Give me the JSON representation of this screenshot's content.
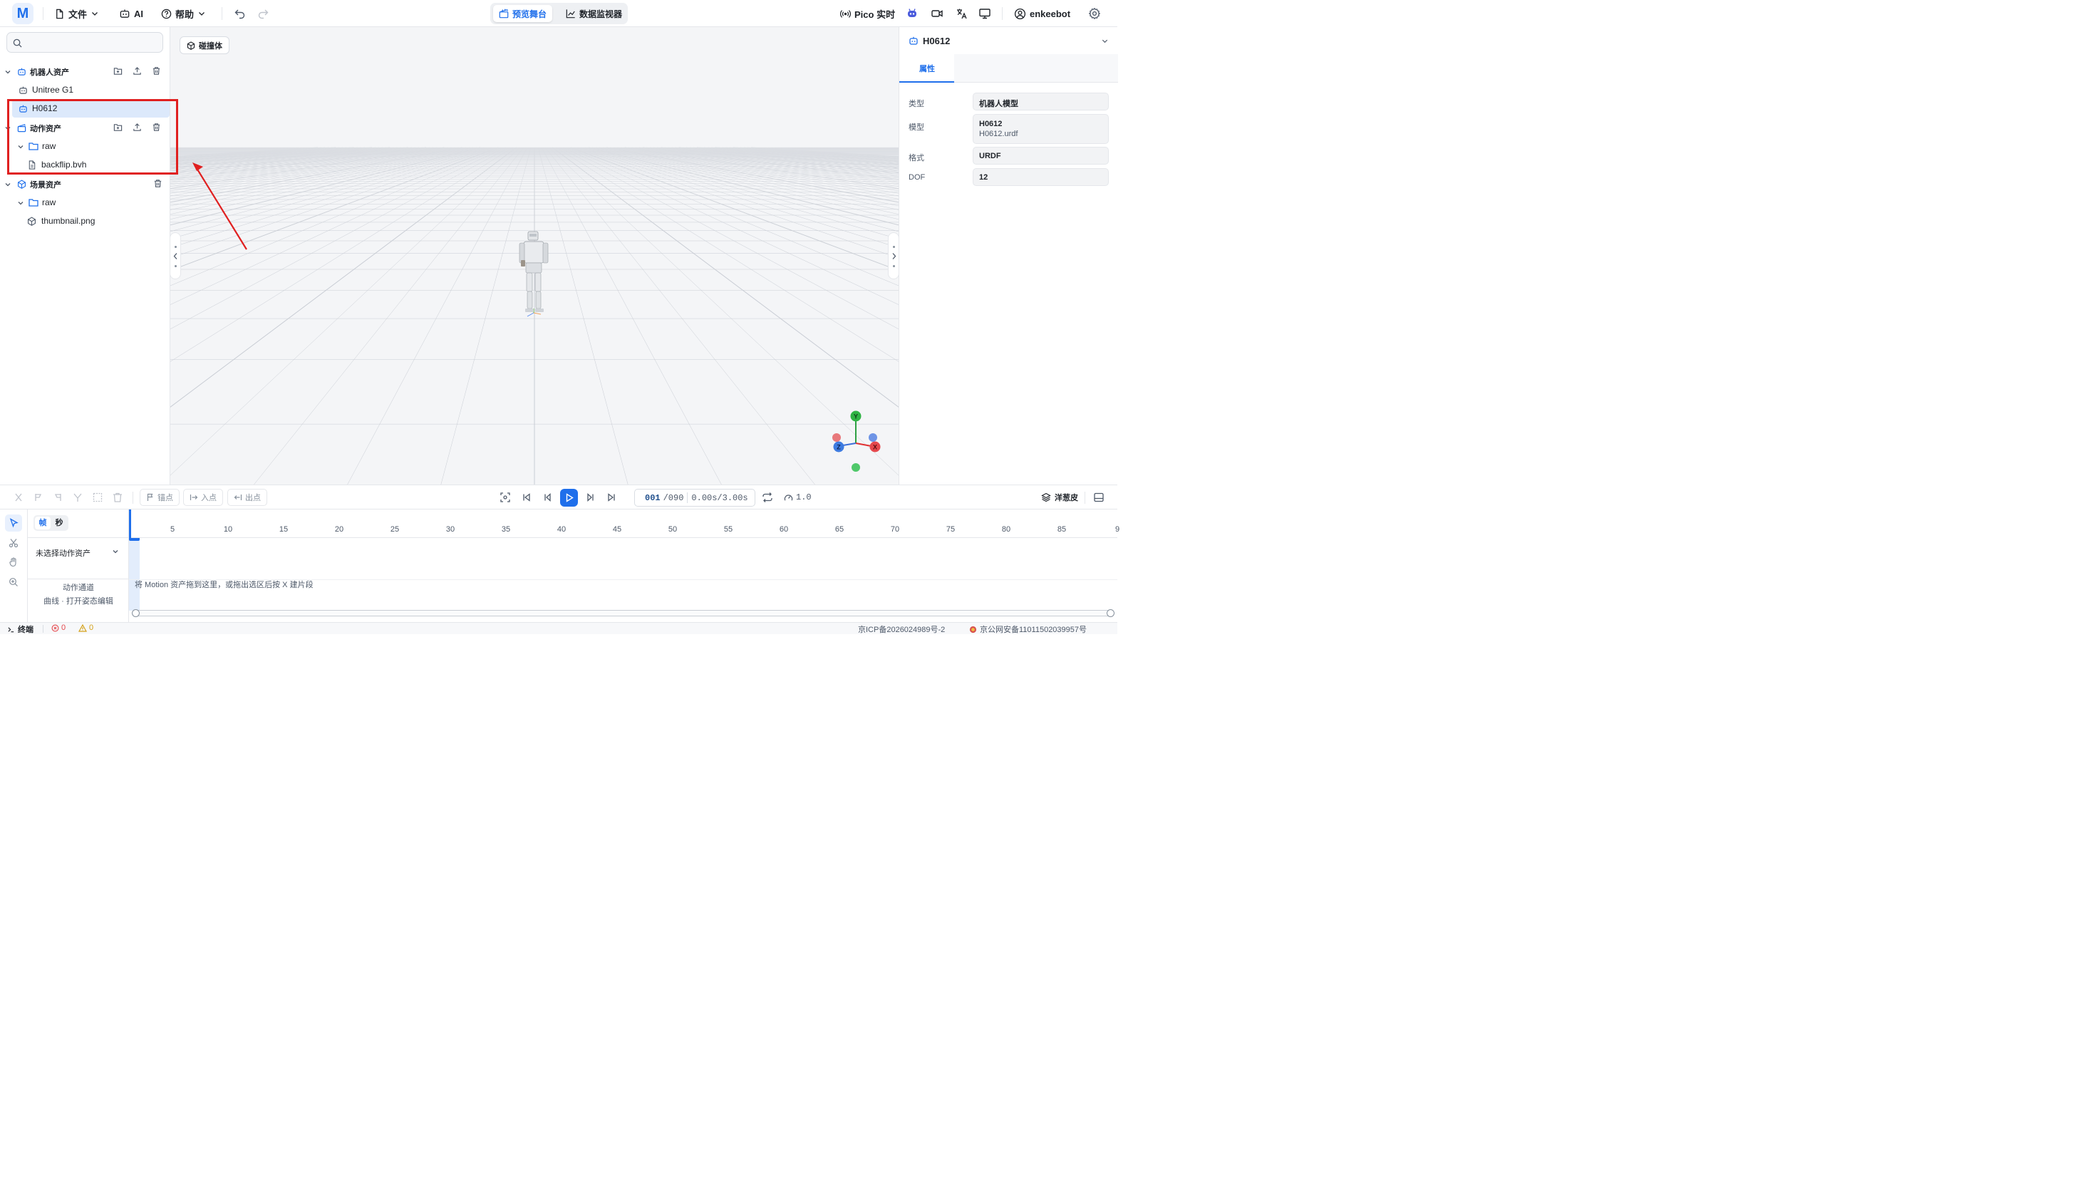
{
  "topbar": {
    "logo": "M",
    "file_menu": "文件",
    "ai_label": "AI",
    "help_menu": "帮助",
    "tabs": [
      {
        "label": "预览舞台",
        "active": true
      },
      {
        "label": "数据监视器",
        "active": false
      }
    ],
    "pico_label": "Pico 实时",
    "username": "enkeebot"
  },
  "left_panel": {
    "search_placeholder": "",
    "sections": [
      {
        "title": "机器人资产",
        "items": [
          "Unitree G1",
          "H0612"
        ],
        "selected": "H0612"
      },
      {
        "title": "动作资产",
        "folder": "raw",
        "files": [
          "backflip.bvh"
        ]
      },
      {
        "title": "场景资产",
        "folder": "raw",
        "files": [
          "thumbnail.png"
        ]
      }
    ]
  },
  "viewport": {
    "collision_button": "碰撞体",
    "axes": {
      "y": "Y",
      "x": "X",
      "z": "Z"
    }
  },
  "right_panel": {
    "title": "H0612",
    "tab": "属性",
    "properties": [
      {
        "label": "类型",
        "value": "机器人模型"
      },
      {
        "label": "模型",
        "value": "H0612",
        "sub": "H0612.urdf"
      },
      {
        "label": "格式",
        "value": "URDF"
      },
      {
        "label": "DOF",
        "value": "12"
      }
    ]
  },
  "timeline": {
    "anchor_btn": "锚点",
    "in_btn": "入点",
    "out_btn": "出点",
    "frame_current": "001",
    "frame_total": "/090",
    "time": "0.00s/3.00s",
    "speed": "1.0",
    "onion_skin": "洋葱皮",
    "mode_frame": "帧",
    "mode_second": "秒",
    "asset_select": "未选择动作资产",
    "track_label_1": "动作通道",
    "track_label_2": "曲线 · 打开姿态编辑",
    "drop_hint": "将 Motion 资产拖到这里，或拖出选区后按 X 建片段",
    "ticks": [
      "5",
      "10",
      "15",
      "20",
      "25",
      "30",
      "35",
      "40",
      "45",
      "50",
      "55",
      "60",
      "65",
      "70",
      "75",
      "80",
      "85",
      "9"
    ]
  },
  "status_bar": {
    "terminal": "终端",
    "errors": "0",
    "warnings": "0",
    "icp": "京ICP备2026024989号-2",
    "police": "京公网安备11011502039957号"
  },
  "colors": {
    "accent": "#1f6feb",
    "annotation_red": "#e02020"
  }
}
